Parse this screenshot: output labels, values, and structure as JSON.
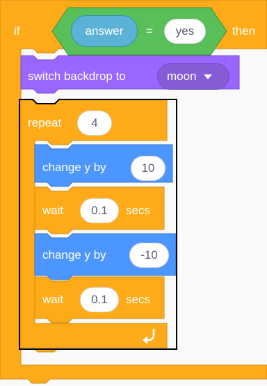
{
  "colors": {
    "control": "#ffab19",
    "control_dark": "#cf8b17",
    "operator": "#59c059",
    "sensing": "#5cb1d6",
    "looks": "#9966ff",
    "motion": "#4c97ff",
    "text": "#ffffff",
    "input_text": "#575e75"
  },
  "if_block": {
    "if_label": "if",
    "then_label": "then",
    "condition": {
      "reporter_label": "answer",
      "operator_label": "=",
      "value": "yes"
    }
  },
  "switch_backdrop": {
    "label": "switch backdrop to",
    "value": "moon"
  },
  "repeat_block": {
    "label": "repeat",
    "count": "4",
    "loop_icon": "loop-arrow-icon"
  },
  "stack": [
    {
      "type": "change_y",
      "label": "change y by",
      "value": "10"
    },
    {
      "type": "wait",
      "label": "wait",
      "value": "0.1",
      "suffix": "secs"
    },
    {
      "type": "change_y",
      "label": "change y by",
      "value": "-10"
    },
    {
      "type": "wait",
      "label": "wait",
      "value": "0.1",
      "suffix": "secs"
    }
  ]
}
